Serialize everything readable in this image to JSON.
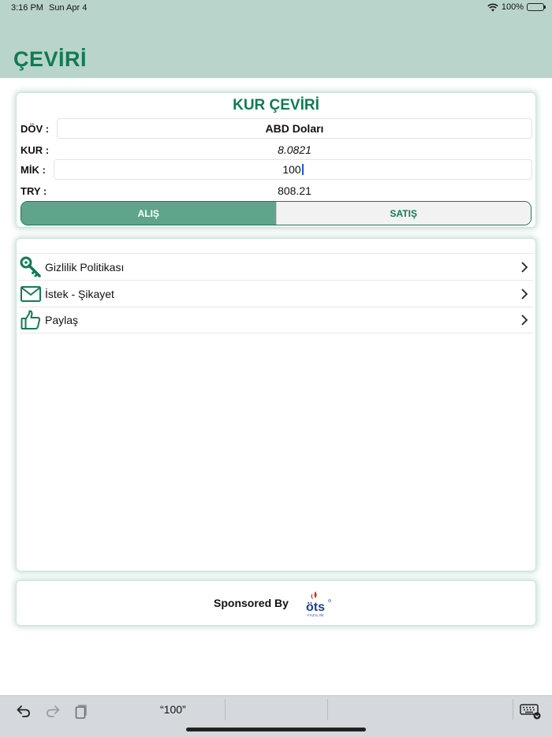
{
  "status_bar": {
    "time": "3:16 PM",
    "date": "Sun Apr 4",
    "battery": "100%",
    "wifi_icon": "wifi-icon",
    "battery_icon": "battery-icon"
  },
  "nav": {
    "title": "ÇEVİRİ"
  },
  "converter": {
    "title": "KUR ÇEVİRİ",
    "currency_label": "DÖV :",
    "currency_value": "ABD Doları",
    "rate_label": "KUR :",
    "rate_value": "8.0821",
    "amount_label": "MİK :",
    "amount_value": "100",
    "result_label": "TRY :",
    "result_value": "808.21",
    "segments": [
      {
        "label": "ALIŞ",
        "selected": true
      },
      {
        "label": "SATIŞ",
        "selected": false
      }
    ]
  },
  "menu": {
    "items": [
      {
        "label": "Gizlilik Politikası",
        "icon": "key-icon"
      },
      {
        "label": "İstek - Şikayet",
        "icon": "envelope-icon"
      },
      {
        "label": "Paylaş",
        "icon": "thumbs-up-icon"
      }
    ]
  },
  "sponsor": {
    "text": "Sponsored By",
    "logo_text": "öts",
    "logo_subtext": "YAZILIM"
  },
  "keyboard_bar": {
    "suggestion": "“100”",
    "icons": [
      "undo-icon",
      "redo-icon",
      "paste-icon",
      "keyboard-icon"
    ]
  },
  "colors": {
    "accent": "#127a53",
    "header_bg": "#b9d5cb",
    "segment_active": "#5fa48b",
    "logo_red": "#d12a2a",
    "logo_blue": "#1d3f8f"
  }
}
